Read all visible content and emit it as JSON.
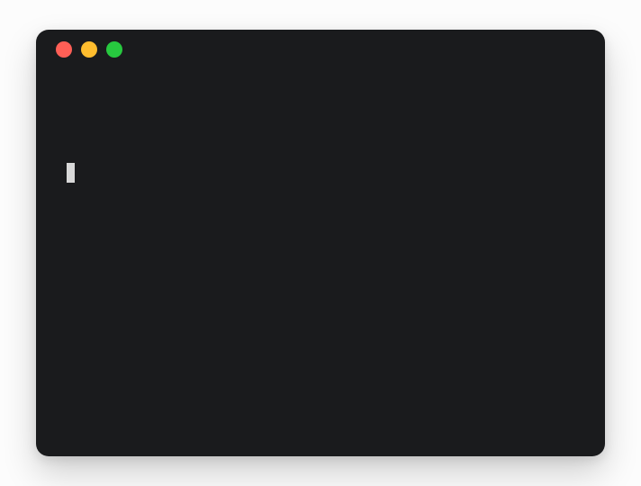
{
  "window": {
    "controls": {
      "close_color": "#ff5f56",
      "minimize_color": "#ffbd2e",
      "zoom_color": "#27c93f"
    }
  },
  "terminal": {
    "prompt_text": "",
    "input_value": ""
  }
}
